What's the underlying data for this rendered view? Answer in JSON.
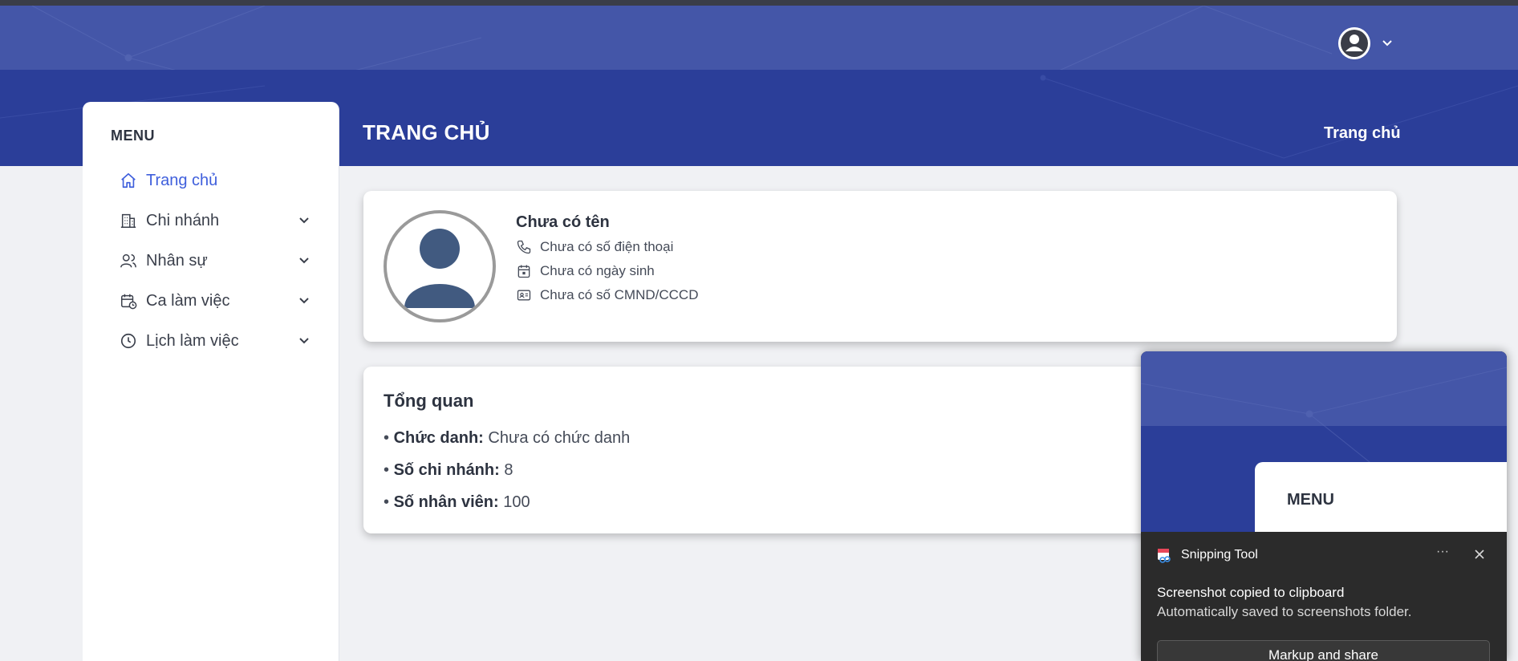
{
  "header": {
    "page_title": "TRANG CHỦ",
    "breadcrumb": "Trang chủ"
  },
  "sidebar": {
    "menu_label": "MENU",
    "items": [
      {
        "label": "Trang chủ",
        "icon": "home-icon",
        "active": true
      },
      {
        "label": "Chi nhánh",
        "icon": "building-icon",
        "expandable": true
      },
      {
        "label": "Nhân sự",
        "icon": "users-icon",
        "expandable": true
      },
      {
        "label": "Ca làm việc",
        "icon": "calendar-clock-icon",
        "expandable": true
      },
      {
        "label": "Lịch làm việc",
        "icon": "clock-icon",
        "expandable": true
      }
    ]
  },
  "profile": {
    "name": "Chưa có tên",
    "phone": "Chưa có số điện thoại",
    "birthday": "Chưa có ngày sinh",
    "id_card": "Chưa có số CMND/CCCD"
  },
  "overview": {
    "title": "Tổng quan",
    "rows": [
      {
        "label": "Chức danh:",
        "value": "Chưa có chức danh"
      },
      {
        "label": "Số chi nhánh:",
        "value": "8"
      },
      {
        "label": "Số nhân viên:",
        "value": "100"
      }
    ]
  },
  "notification": {
    "app_name": "Snipping Tool",
    "more_label": "···",
    "title": "Screenshot copied to clipboard",
    "subtitle": "Automatically saved to screenshots folder.",
    "button_label": "Markup and share",
    "preview_menu_label": "MENU"
  },
  "colors": {
    "header_light": "#4456a8",
    "header_dark": "#2b3e99",
    "accent": "#3f5fdc",
    "background": "#f0f1f4"
  }
}
